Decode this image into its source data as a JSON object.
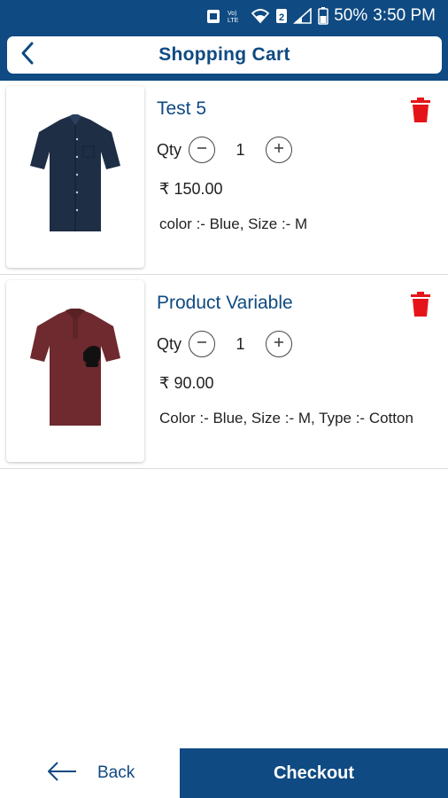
{
  "status_bar": {
    "battery": "50%",
    "time": "3:50 PM",
    "sim_badge": "2",
    "volte": "Vo)) LTE"
  },
  "header": {
    "title": "Shopping Cart",
    "back_icon": "chevron-left-icon"
  },
  "cart": {
    "items": [
      {
        "name": "Test 5",
        "qty_label": "Qty",
        "qty": "1",
        "price": "₹ 150.00",
        "attributes": "color :- Blue, Size :- M",
        "image": "navy-shirt-image",
        "shirt_color": "#1e2e45"
      },
      {
        "name": "Product Variable",
        "qty_label": "Qty",
        "qty": "1",
        "price": "₹ 90.00",
        "attributes": "Color :- Blue, Size :- M, Type :- Cotton",
        "image": "maroon-polo-image",
        "shirt_color": "#6e2a2e"
      }
    ]
  },
  "footer": {
    "back_label": "Back",
    "checkout_label": "Checkout"
  },
  "colors": {
    "brand": "#0f4a82",
    "delete": "#e5141b"
  }
}
